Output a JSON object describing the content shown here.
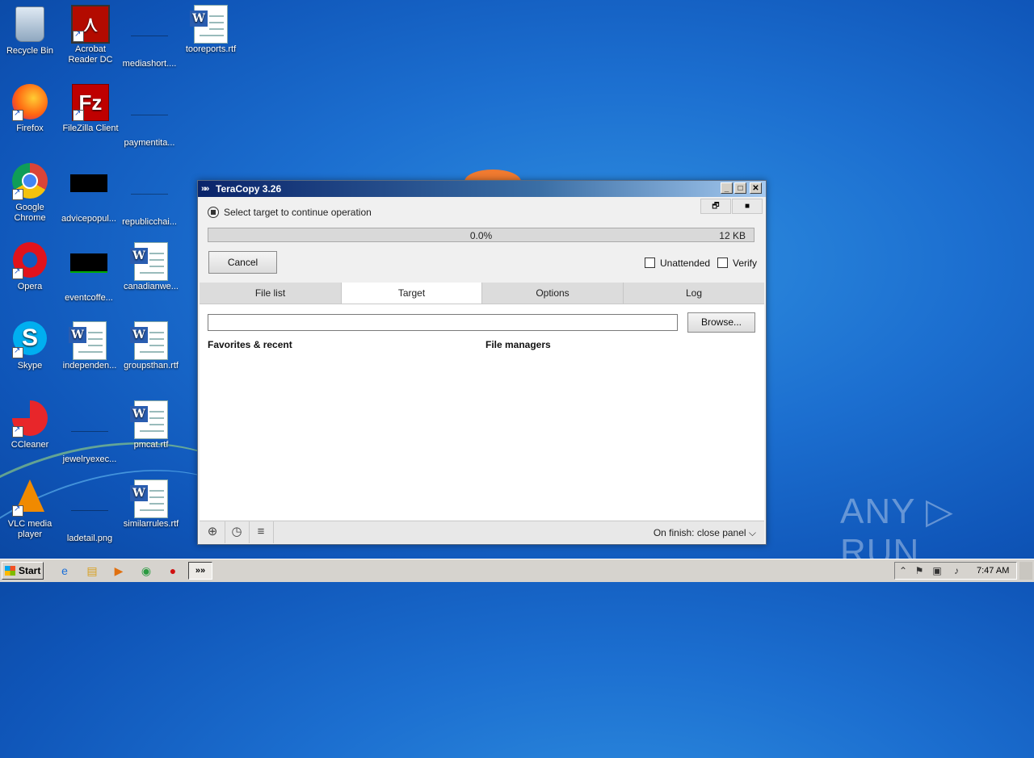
{
  "desktop": {
    "icons": [
      {
        "label": "Recycle Bin",
        "icon": "recycle-bin-icon"
      },
      {
        "label": "Acrobat Reader DC",
        "icon": "acrobat-icon"
      },
      {
        "label": "mediashort....",
        "icon": "blank-file-icon"
      },
      {
        "label": "tooreports.rtf",
        "icon": "word-doc-icon"
      },
      {
        "label": "Firefox",
        "icon": "firefox-icon"
      },
      {
        "label": "FileZilla Client",
        "icon": "filezilla-icon"
      },
      {
        "label": "paymentita...",
        "icon": "blank-file-icon"
      },
      {
        "label": "Google Chrome",
        "icon": "chrome-icon"
      },
      {
        "label": "advicepopul...",
        "icon": "black-image-icon"
      },
      {
        "label": "republicchai...",
        "icon": "blank-file-icon"
      },
      {
        "label": "Opera",
        "icon": "opera-icon"
      },
      {
        "label": "eventcoffe...",
        "icon": "black-image-icon"
      },
      {
        "label": "canadianwe...",
        "icon": "word-doc-icon"
      },
      {
        "label": "Skype",
        "icon": "skype-icon"
      },
      {
        "label": "independen...",
        "icon": "word-doc-icon"
      },
      {
        "label": "groupsthan.rtf",
        "icon": "word-doc-icon"
      },
      {
        "label": "CCleaner",
        "icon": "ccleaner-icon"
      },
      {
        "label": "jewelryexec...",
        "icon": "blank-file-icon"
      },
      {
        "label": "pmcat.rtf",
        "icon": "word-doc-icon"
      },
      {
        "label": "VLC media player",
        "icon": "vlc-icon"
      },
      {
        "label": "ladetail.png",
        "icon": "blank-file-icon"
      },
      {
        "label": "similarrules.rtf",
        "icon": "word-doc-icon"
      }
    ]
  },
  "window": {
    "title": "TeraCopy 3.26",
    "min_label": "_",
    "max_label": "□",
    "close_label": "✕",
    "status_text": "Select target to continue operation",
    "progress": {
      "percent_label": "0.0%",
      "size_label": "12 KB",
      "fraction": 0.0
    },
    "cancel_label": "Cancel",
    "unattended_label": "Unattended",
    "verify_label": "Verify",
    "tabs": [
      "File list",
      "Target",
      "Options",
      "Log"
    ],
    "active_tab": "Target",
    "target_path": "",
    "browse_label": "Browse...",
    "favorites_heading": "Favorites & recent",
    "file_managers_heading": "File managers",
    "on_finish_label": "On finish: close panel ⌵"
  },
  "watermark": "ANY ▷ RUN",
  "taskbar": {
    "start_label": "Start",
    "clock": "7:47 AM"
  },
  "colors": {
    "titlebar_start": "#0a246a",
    "titlebar_end": "#a6caf0",
    "desktop": "#1c6fd0",
    "progress_fill": "#9ec9f5"
  }
}
